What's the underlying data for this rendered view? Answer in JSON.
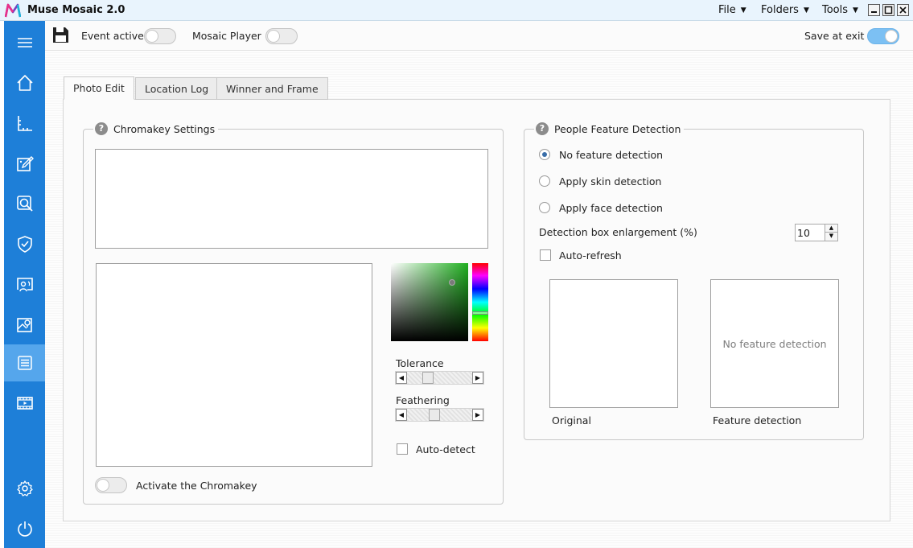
{
  "app": {
    "title": "Muse Mosaic 2.0",
    "accent": "#1e7fd8",
    "active_sidebar": "#55a6ec"
  },
  "menu": {
    "file": "File",
    "folders": "Folders",
    "tools": "Tools"
  },
  "sidebar": {
    "items": [
      {
        "icon": "hamburger-menu-icon"
      },
      {
        "icon": "home-icon"
      },
      {
        "icon": "ruler-icon"
      },
      {
        "icon": "photo-edit-icon"
      },
      {
        "icon": "search-icon"
      },
      {
        "icon": "shield-check-icon"
      },
      {
        "icon": "cast-screen-icon"
      },
      {
        "icon": "image-location-icon"
      },
      {
        "icon": "checklist-icon",
        "active": true
      },
      {
        "icon": "film-icon"
      },
      {
        "icon": "gear-icon"
      },
      {
        "icon": "power-icon"
      }
    ]
  },
  "toolbar": {
    "save_icon": "save-icon",
    "event_active_label": "Event active",
    "event_active_on": false,
    "mosaic_player_label": "Mosaic Player",
    "mosaic_player_on": false,
    "save_at_exit_label": "Save at exit",
    "save_at_exit_on": true
  },
  "tabs": [
    "Photo Edit",
    "Location Log",
    "Winner and Frame"
  ],
  "chromakey": {
    "title": "Chromakey Settings",
    "picked_color": "#1faf1f",
    "tolerance_label": "Tolerance",
    "tolerance_value": 0.28,
    "feathering_label": "Feathering",
    "feathering_value": 0.41,
    "auto_detect_label": "Auto-detect",
    "auto_detect_checked": false,
    "activate_label": "Activate the Chromakey",
    "activate_on": false
  },
  "feature_detection": {
    "title": "People Feature Detection",
    "options": [
      {
        "label": "No feature detection",
        "checked": true
      },
      {
        "label": "Apply skin detection",
        "checked": false
      },
      {
        "label": "Apply face detection",
        "checked": false
      }
    ],
    "enlargement_label": "Detection box enlargement (%)",
    "enlargement_value": "10",
    "auto_refresh_label": "Auto-refresh",
    "auto_refresh_checked": false,
    "original_label": "Original",
    "feature_label": "Feature detection",
    "preview_placeholder": "No feature detection"
  }
}
